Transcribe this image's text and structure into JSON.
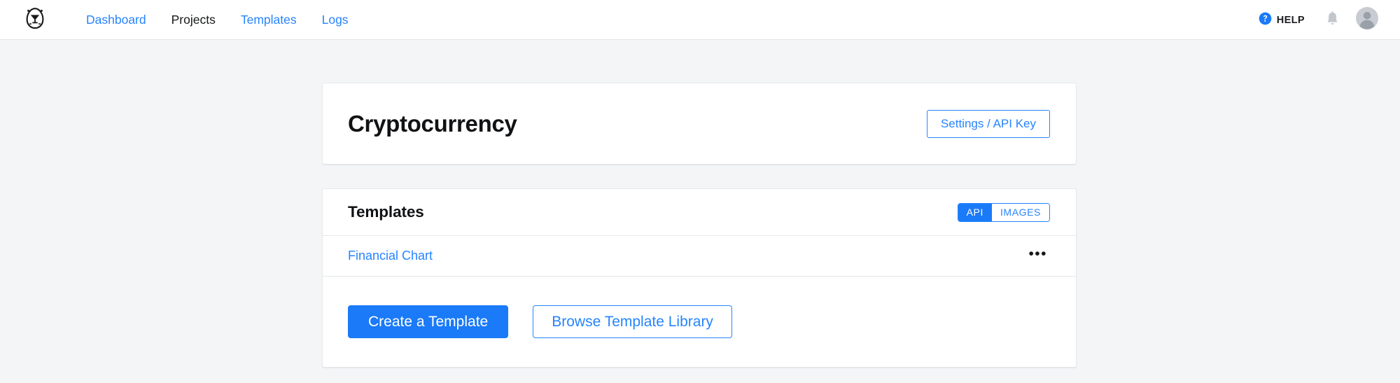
{
  "navbar": {
    "logo_icon": "bot-egg-logo-icon",
    "links": [
      {
        "label": "Dashboard",
        "active": false
      },
      {
        "label": "Projects",
        "active": true
      },
      {
        "label": "Templates",
        "active": false
      },
      {
        "label": "Logs",
        "active": false
      }
    ],
    "help": {
      "label": "HELP",
      "icon": "question-circle-icon"
    },
    "notifications_icon": "bell-icon",
    "avatar_icon": "user-avatar-icon"
  },
  "project_card": {
    "title": "Cryptocurrency",
    "settings_button": "Settings / API Key"
  },
  "templates_card": {
    "title": "Templates",
    "view_toggle": {
      "options": [
        {
          "label": "API",
          "selected": true
        },
        {
          "label": "IMAGES",
          "selected": false
        }
      ]
    },
    "rows": [
      {
        "name": "Financial Chart",
        "menu": "•••"
      }
    ],
    "actions": {
      "primary": "Create a Template",
      "secondary": "Browse Template Library"
    }
  },
  "colors": {
    "accent_blue": "#2684ff",
    "primary_blue": "#1a7af8",
    "page_background": "#f4f5f7",
    "card_background": "#ffffff",
    "border": "#e6e7e9",
    "text_dark": "#111214",
    "icon_gray": "#c1c7d0"
  }
}
